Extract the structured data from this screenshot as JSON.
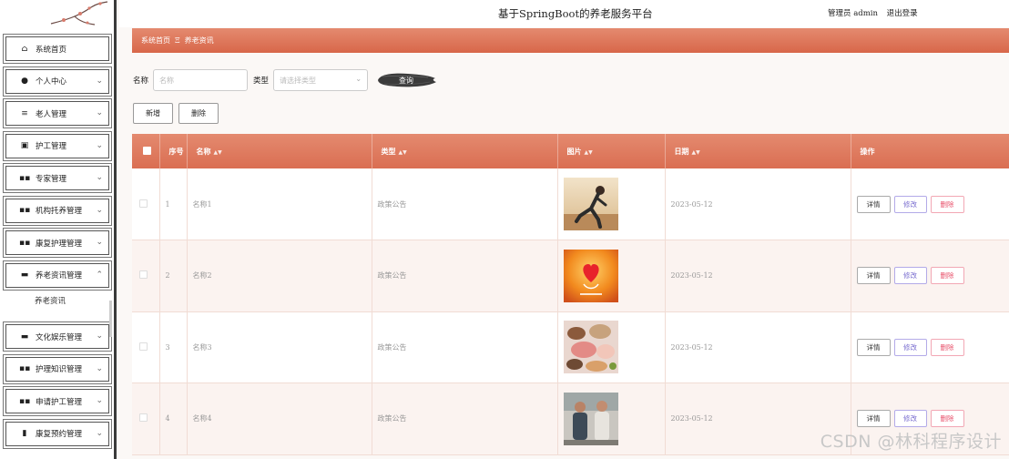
{
  "header": {
    "title": "基于SpringBoot的养老服务平台",
    "user": "管理员 admin",
    "logout": "退出登录"
  },
  "breadcrumb": {
    "home": "系统首页",
    "separator": "Ξ",
    "current": "养老资讯"
  },
  "sidebar": {
    "items": [
      {
        "label": "系统首页",
        "icon": "home-icon"
      },
      {
        "label": "个人中心",
        "icon": "user-icon"
      },
      {
        "label": "老人管理",
        "icon": "list-icon"
      },
      {
        "label": "护工管理",
        "icon": "clipboard-icon"
      },
      {
        "label": "专家管理",
        "icon": "grid-icon"
      },
      {
        "label": "机构托养管理",
        "icon": "grid-icon"
      },
      {
        "label": "康复护理管理",
        "icon": "grid-icon"
      },
      {
        "label": "养老资讯管理",
        "icon": "monitor-icon",
        "expanded": true
      },
      {
        "label": "文化娱乐管理",
        "icon": "monitor-icon"
      },
      {
        "label": "护理知识管理",
        "icon": "grid-icon"
      },
      {
        "label": "申请护工管理",
        "icon": "grid-icon"
      },
      {
        "label": "康复预约管理",
        "icon": "bar-chart-icon"
      }
    ],
    "submenu": {
      "label": "养老资讯"
    }
  },
  "search": {
    "name_label": "名称",
    "name_placeholder": "名称",
    "type_label": "类型",
    "type_placeholder": "请选择类型",
    "button": "查询"
  },
  "actions": {
    "add": "新增",
    "delete": "删除"
  },
  "table": {
    "columns": [
      "序号",
      "名称",
      "类型",
      "图片",
      "日期",
      "操作"
    ],
    "rows": [
      {
        "index": "1",
        "name": "名称1",
        "type": "政策公告",
        "image": "runner-photo",
        "date": "2023-05-12"
      },
      {
        "index": "2",
        "name": "名称2",
        "type": "政策公告",
        "image": "heart-poster",
        "date": "2023-05-12"
      },
      {
        "index": "3",
        "name": "名称3",
        "type": "政策公告",
        "image": "food-photo",
        "date": "2023-05-12"
      },
      {
        "index": "4",
        "name": "名称4",
        "type": "政策公告",
        "image": "people-photo",
        "date": "2023-05-12"
      }
    ],
    "ops": {
      "detail": "详情",
      "edit": "修改",
      "delete": "删除"
    }
  },
  "watermark": "CSDN @林科程序设计",
  "colors": {
    "accent": "#da6e52",
    "edit": "#7b6fd0",
    "danger": "#e8506a"
  }
}
